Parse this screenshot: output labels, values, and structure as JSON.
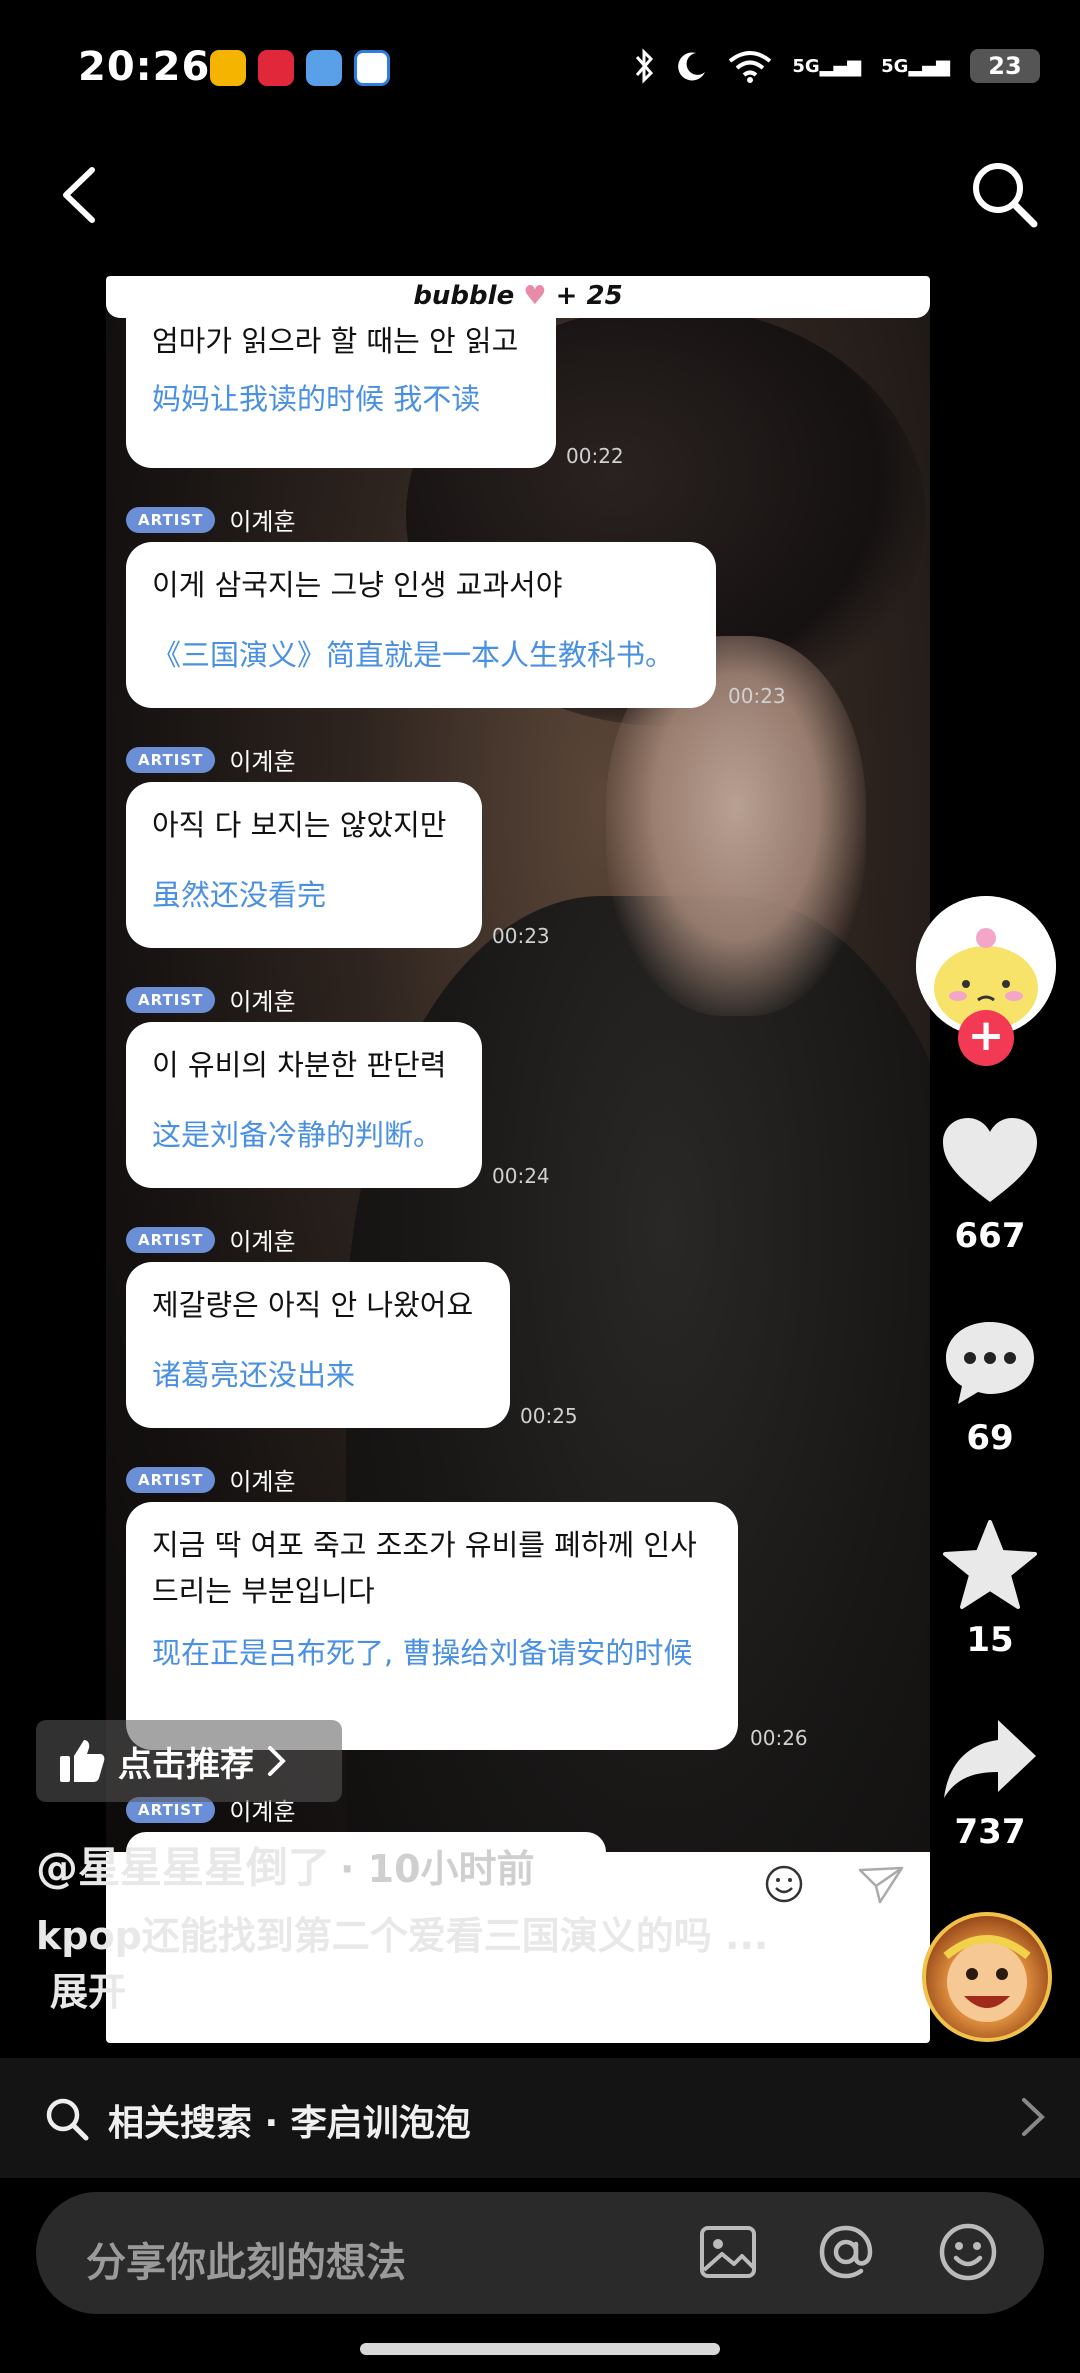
{
  "status_bar": {
    "time": "20:26",
    "battery": "23",
    "signal1": "5G",
    "signal2": "5G"
  },
  "bubble_header": {
    "brand": "bubble",
    "count": "+ 25"
  },
  "messages": [
    {
      "ko": "엄마가 읽으라 할 때는 안 읽고",
      "zh": "妈妈让我读的时候 我不读",
      "time": "00:22"
    },
    {
      "sender_tag": "ARTIST",
      "sender": "이계훈",
      "ko": "이게 삼국지는 그냥 인생 교과서야",
      "zh": "《三国演义》简直就是一本人生教科书。",
      "time": "00:23"
    },
    {
      "sender_tag": "ARTIST",
      "sender": "이계훈",
      "ko": "아직 다 보지는 않았지만",
      "zh": "虽然还没看完",
      "time": "00:23"
    },
    {
      "sender_tag": "ARTIST",
      "sender": "이계훈",
      "ko": "이 유비의 차분한 판단력",
      "zh": "这是刘备冷静的判断。",
      "time": "00:24"
    },
    {
      "sender_tag": "ARTIST",
      "sender": "이계훈",
      "ko": "제갈량은 아직 안 나왔어요",
      "zh": "诸葛亮还没出来",
      "time": "00:25"
    },
    {
      "sender_tag": "ARTIST",
      "sender": "이계훈",
      "ko": "지금 딱 여포 죽고 조조가 유비를 폐하께 인사 드리는 부분입니다",
      "zh": "现在正是吕布死了, 曹操给刘备请安的时候",
      "time": "00:26"
    },
    {
      "sender_tag": "ARTIST",
      "sender": "이계훈"
    }
  ],
  "actions": {
    "likes": "667",
    "comments": "69",
    "favorites": "15",
    "shares": "737"
  },
  "recommend_label": "点击推荐",
  "author": {
    "name": "@星星星星倒了",
    "when": "· 10小时前"
  },
  "caption": {
    "text": "kpop还能找到第二个爱看三国演义的吗 ...",
    "more": "展开"
  },
  "related_search": "相关搜索 · 李启训泡泡",
  "comment_placeholder": "分享你此刻的想法"
}
